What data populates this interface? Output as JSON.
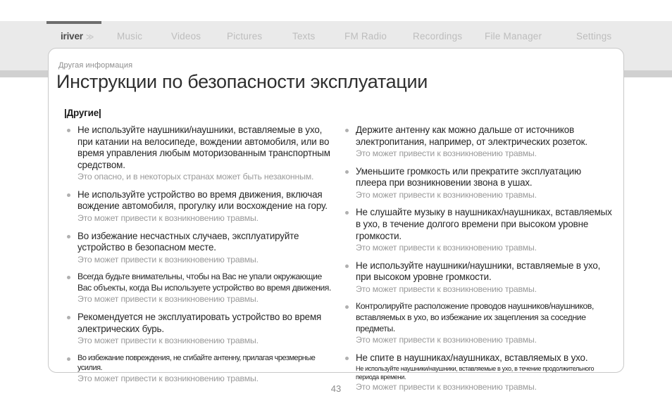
{
  "nav": {
    "brand": "iriver",
    "brand_chevrons": "≫",
    "items": [
      {
        "label": "Music"
      },
      {
        "label": "Videos"
      },
      {
        "label": "Pictures"
      },
      {
        "label": "Texts"
      },
      {
        "label": "FM Radio"
      },
      {
        "label": "Recordings"
      },
      {
        "label": "File Manager"
      },
      {
        "label": "Settings"
      }
    ],
    "active": "iriver"
  },
  "header": {
    "eyebrow": "Другая информация",
    "title": "Инструкции по безопасности эксплуатации"
  },
  "section": {
    "heading_bar_left": "|",
    "heading": "Другие",
    "heading_bar_right": "|"
  },
  "left_column": [
    {
      "main": "Не используйте наушники/наушники, вставляемые в ухо, при катании на велосипеде, вождении автомобиля, или во время управления любым моторизованным транспортным средством.",
      "sub": "Это опасно, и в некоторых странах может быть незаконным.",
      "size": "normal"
    },
    {
      "main": "Не используйте устройство во время движения, включая вождение автомобиля, прогулку или восхождение на гору.",
      "sub": "Это может привести к возникновению травмы.",
      "size": "normal"
    },
    {
      "main": "Во избежание несчастных случаев, эксплуатируйте устройство в безопасном месте.",
      "sub": "Это может привести к возникновению травмы.",
      "size": "normal"
    },
    {
      "main": "Всегда будьте внимательны, чтобы на Вас не упали окружающие Вас объекты, когда Вы используете устройство во время движения.",
      "sub": "Это может привести к возникновению травмы.",
      "size": "narrow"
    },
    {
      "main": "Рекомендуется не эксплуатировать устройство во время электрических бурь.",
      "sub": "Это может привести к возникновению травмы.",
      "size": "normal"
    },
    {
      "main": "Во избежание повреждения, не сгибайте антенну, прилагая чрезмерные усилия.",
      "sub": "Это может привести к возникновению травмы.",
      "size": "tiny"
    }
  ],
  "right_column": [
    {
      "main": "Держите антенну как можно дальше от источников электропитания, например, от электрических розеток.",
      "sub": "Это может привести к возникновению травмы.",
      "size": "normal"
    },
    {
      "main": "Уменьшите громкость или прекратите эксплуатацию плеера при возникновении звона в ушах.",
      "sub": "Это может привести к возникновению травмы.",
      "size": "normal"
    },
    {
      "main": "Не слушайте музыку в наушниках/наушниках, вставляемых в ухо, в течение долгого времени при высоком уровне громкости.",
      "sub": "Это может привести к возникновению травмы.",
      "size": "normal"
    },
    {
      "main": "Не используйте наушники/наушники, вставляемые в ухо, при высоком уровне громкости.",
      "sub": "Это может привести к возникновению травмы.",
      "size": "normal"
    },
    {
      "main": "Контролируйте расположение проводов наушников/наушников, вставляемых в ухо, во избежание их зацепления за соседние предметы.",
      "sub": "Это может привести к возникновению травмы.",
      "size": "narrow"
    },
    {
      "main": "Не спите в наушниках/наушниках, вставляемых в ухо.",
      "mini": "Не используйте наушники/наушники, вставляемые в ухо, в течение продолжительного периода времени.",
      "sub": "Это может привести к возникновению травмы.",
      "size": "normal"
    }
  ],
  "footer": {
    "page_number": "43"
  },
  "colors": {
    "nav_band": "#eaeaea",
    "nav_shadow": "#d0d0d0",
    "active_marker": "#6d6d6d",
    "card_border": "#c9c9c9",
    "main_text": "#262626",
    "sub_text": "#9a9a9a",
    "bullet": "#b0b0b0"
  }
}
